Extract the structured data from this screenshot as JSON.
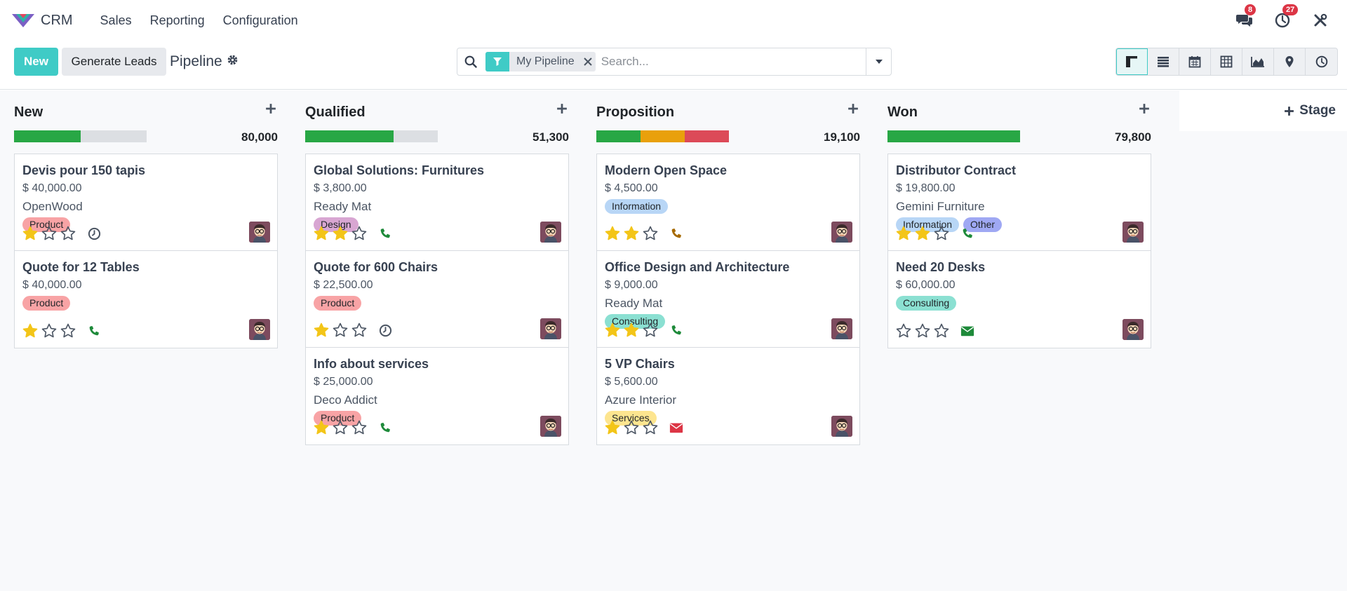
{
  "app": {
    "name": "CRM"
  },
  "nav": {
    "items": [
      {
        "label": "Sales"
      },
      {
        "label": "Reporting"
      },
      {
        "label": "Configuration"
      }
    ]
  },
  "systray": {
    "messages_count": "8",
    "activities_count": "27"
  },
  "control": {
    "new_label": "New",
    "generate_label": "Generate Leads",
    "breadcrumb": "Pipeline",
    "filter_label": "My Pipeline",
    "search_placeholder": "Search..."
  },
  "add_stage_label": "Stage",
  "colors": {
    "accent": "#3fcbc6",
    "green": "#28a745",
    "orange": "#e9a00b",
    "red": "#dc4a58",
    "grey": "#dcdfe3",
    "star": "#f3c518"
  },
  "columns": [
    {
      "title": "New",
      "total": "80,000",
      "progress": [
        {
          "color": "#28a745",
          "fraction": 0.5
        },
        {
          "color": "#dcdfe3",
          "fraction": 0.5
        }
      ],
      "cards": [
        {
          "title": "Devis pour 150 tapis",
          "amount": "$ 40,000.00",
          "company": "OpenWood",
          "tags": [
            {
              "label": "Product",
              "color": "#f8a3a5"
            }
          ],
          "stars": 1,
          "activity": "clock-icon"
        },
        {
          "title": "Quote for 12 Tables",
          "amount": "$ 40,000.00",
          "company": "",
          "tags": [
            {
              "label": "Product",
              "color": "#f8a3a5"
            }
          ],
          "stars": 1,
          "activity": "phone-icon"
        }
      ]
    },
    {
      "title": "Qualified",
      "total": "51,300",
      "progress": [
        {
          "color": "#28a745",
          "fraction": 0.667
        },
        {
          "color": "#dcdfe3",
          "fraction": 0.333
        }
      ],
      "cards": [
        {
          "title": "Global Solutions: Furnitures",
          "amount": "$ 3,800.00",
          "company": "Ready Mat",
          "tags": [
            {
              "label": "Design",
              "color": "#d8a6d2"
            }
          ],
          "stars": 2,
          "activity": "phone-icon"
        },
        {
          "title": "Quote for 600 Chairs",
          "amount": "$ 22,500.00",
          "company": "",
          "tags": [
            {
              "label": "Product",
              "color": "#f8a3a5"
            }
          ],
          "stars": 1,
          "activity": "clock-icon"
        },
        {
          "title": "Info about services",
          "amount": "$ 25,000.00",
          "company": "Deco Addict",
          "tags": [
            {
              "label": "Product",
              "color": "#f8a3a5"
            }
          ],
          "stars": 1,
          "activity": "phone-icon"
        }
      ]
    },
    {
      "title": "Proposition",
      "total": "19,100",
      "progress": [
        {
          "color": "#28a745",
          "fraction": 0.333
        },
        {
          "color": "#e9a00b",
          "fraction": 0.333
        },
        {
          "color": "#dc4a58",
          "fraction": 0.334
        }
      ],
      "cards": [
        {
          "title": "Modern Open Space",
          "amount": "$ 4,500.00",
          "company": "",
          "tags": [
            {
              "label": "Information",
              "color": "#b8d6f6"
            }
          ],
          "stars": 2,
          "activity": "phone-warning-icon"
        },
        {
          "title": "Office Design and Architecture",
          "amount": "$ 9,000.00",
          "company": "Ready Mat",
          "tags": [
            {
              "label": "Consulting",
              "color": "#8be0d2"
            }
          ],
          "stars": 2,
          "activity": "phone-icon"
        },
        {
          "title": "5 VP Chairs",
          "amount": "$ 5,600.00",
          "company": "Azure Interior",
          "tags": [
            {
              "label": "Services",
              "color": "#fde58f"
            }
          ],
          "stars": 1,
          "activity": "envelope-danger-icon"
        }
      ]
    },
    {
      "title": "Won",
      "total": "79,800",
      "progress": [
        {
          "color": "#28a745",
          "fraction": 1.0
        }
      ],
      "cards": [
        {
          "title": "Distributor Contract",
          "amount": "$ 19,800.00",
          "company": "Gemini Furniture",
          "tags": [
            {
              "label": "Information",
              "color": "#b8d6f6"
            },
            {
              "label": "Other",
              "color": "#9fa8f3"
            }
          ],
          "stars": 2,
          "activity": "phone-icon"
        },
        {
          "title": "Need 20 Desks",
          "amount": "$ 60,000.00",
          "company": "",
          "tags": [
            {
              "label": "Consulting",
              "color": "#8be0d2"
            }
          ],
          "stars": 0,
          "activity": "envelope-icon"
        }
      ]
    }
  ]
}
